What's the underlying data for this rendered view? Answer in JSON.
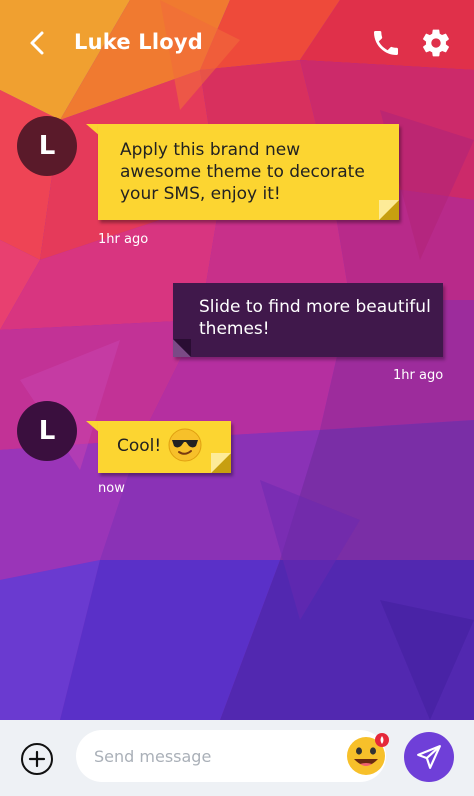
{
  "header": {
    "contact_name": "Luke Lloyd",
    "back_icon": "chevron-left-icon",
    "call_icon": "phone-icon",
    "settings_icon": "gear-icon"
  },
  "messages": [
    {
      "direction": "incoming",
      "avatar_initial": "L",
      "text": "Apply this brand new awesome theme to decorate your SMS, enjoy it!",
      "time": "1hr ago"
    },
    {
      "direction": "outgoing",
      "text": "Slide to find more beautiful themes!",
      "time": "1hr ago"
    },
    {
      "direction": "incoming",
      "avatar_initial": "L",
      "text": "Cool!",
      "emoji": "sunglasses-emoji",
      "time": "now"
    }
  ],
  "composer": {
    "placeholder": "Send message",
    "value": "",
    "add_icon": "plus-circle-icon",
    "sticker_icon": "smiley-sticker-icon",
    "send_icon": "paper-plane-icon"
  },
  "colors": {
    "incoming_bubble": "#fcd531",
    "outgoing_bubble": "#40184b",
    "send_button": "#6f3fd8",
    "composer_bg": "#eef1f5"
  }
}
